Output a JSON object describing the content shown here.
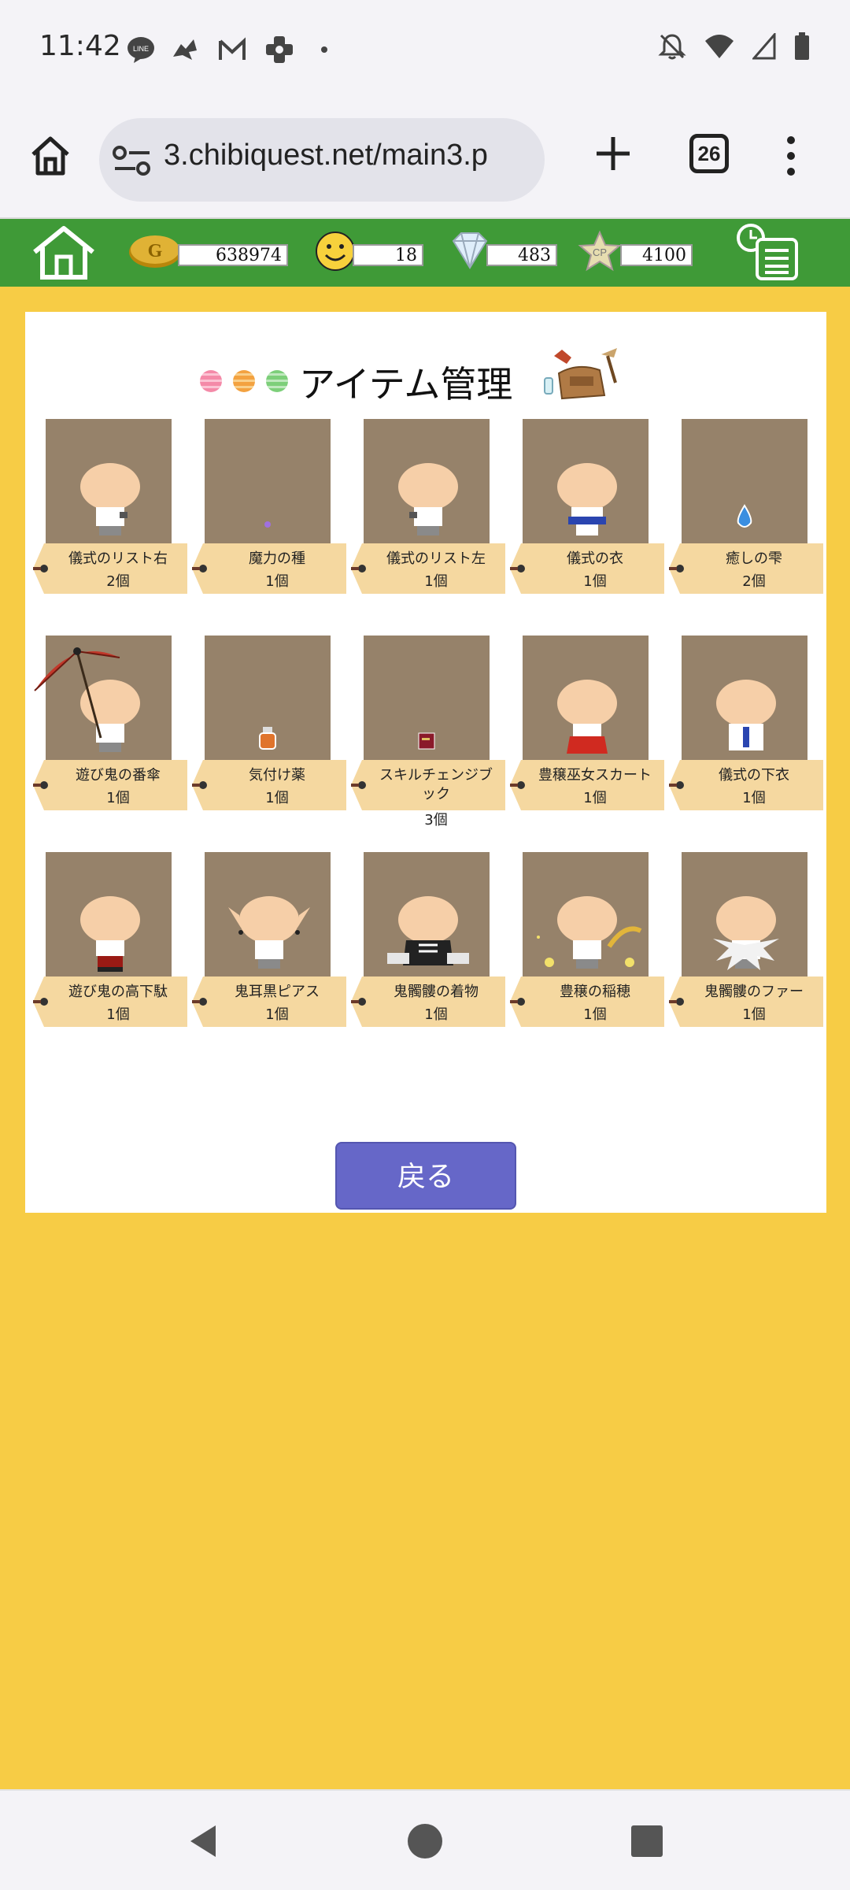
{
  "status_bar": {
    "time": "11:42"
  },
  "browser": {
    "url": "3.chibiquest.net/main3.p",
    "tab_count": "26"
  },
  "game_header": {
    "gold": "638974",
    "smile": "18",
    "diamond": "483",
    "cp": "4100"
  },
  "panel": {
    "title": "アイテム管理",
    "back_label": "戻る"
  },
  "items": [
    {
      "name": "儀式のリスト右",
      "qty": "2個"
    },
    {
      "name": "魔力の種",
      "qty": "1個"
    },
    {
      "name": "儀式のリスト左",
      "qty": "1個"
    },
    {
      "name": "儀式の衣",
      "qty": "1個"
    },
    {
      "name": "癒しの雫",
      "qty": "2個"
    },
    {
      "name": "遊び鬼の番傘",
      "qty": "1個"
    },
    {
      "name": "気付け薬",
      "qty": "1個"
    },
    {
      "name": "スキルチェンジブック",
      "qty": "3個"
    },
    {
      "name": "豊穣巫女スカート",
      "qty": "1個"
    },
    {
      "name": "儀式の下衣",
      "qty": "1個"
    },
    {
      "name": "遊び鬼の高下駄",
      "qty": "1個"
    },
    {
      "name": "鬼耳黒ピアス",
      "qty": "1個"
    },
    {
      "name": "鬼髑髏の着物",
      "qty": "1個"
    },
    {
      "name": "豊穣の稲穂",
      "qty": "1個"
    },
    {
      "name": "鬼髑髏のファー",
      "qty": "1個"
    }
  ],
  "colors": {
    "page_bg": "#f7cc45",
    "header_green": "#3f9a37",
    "thumb_bg": "#96826a",
    "tag_bg": "#f5d8a0",
    "back_button": "#6667c8"
  }
}
